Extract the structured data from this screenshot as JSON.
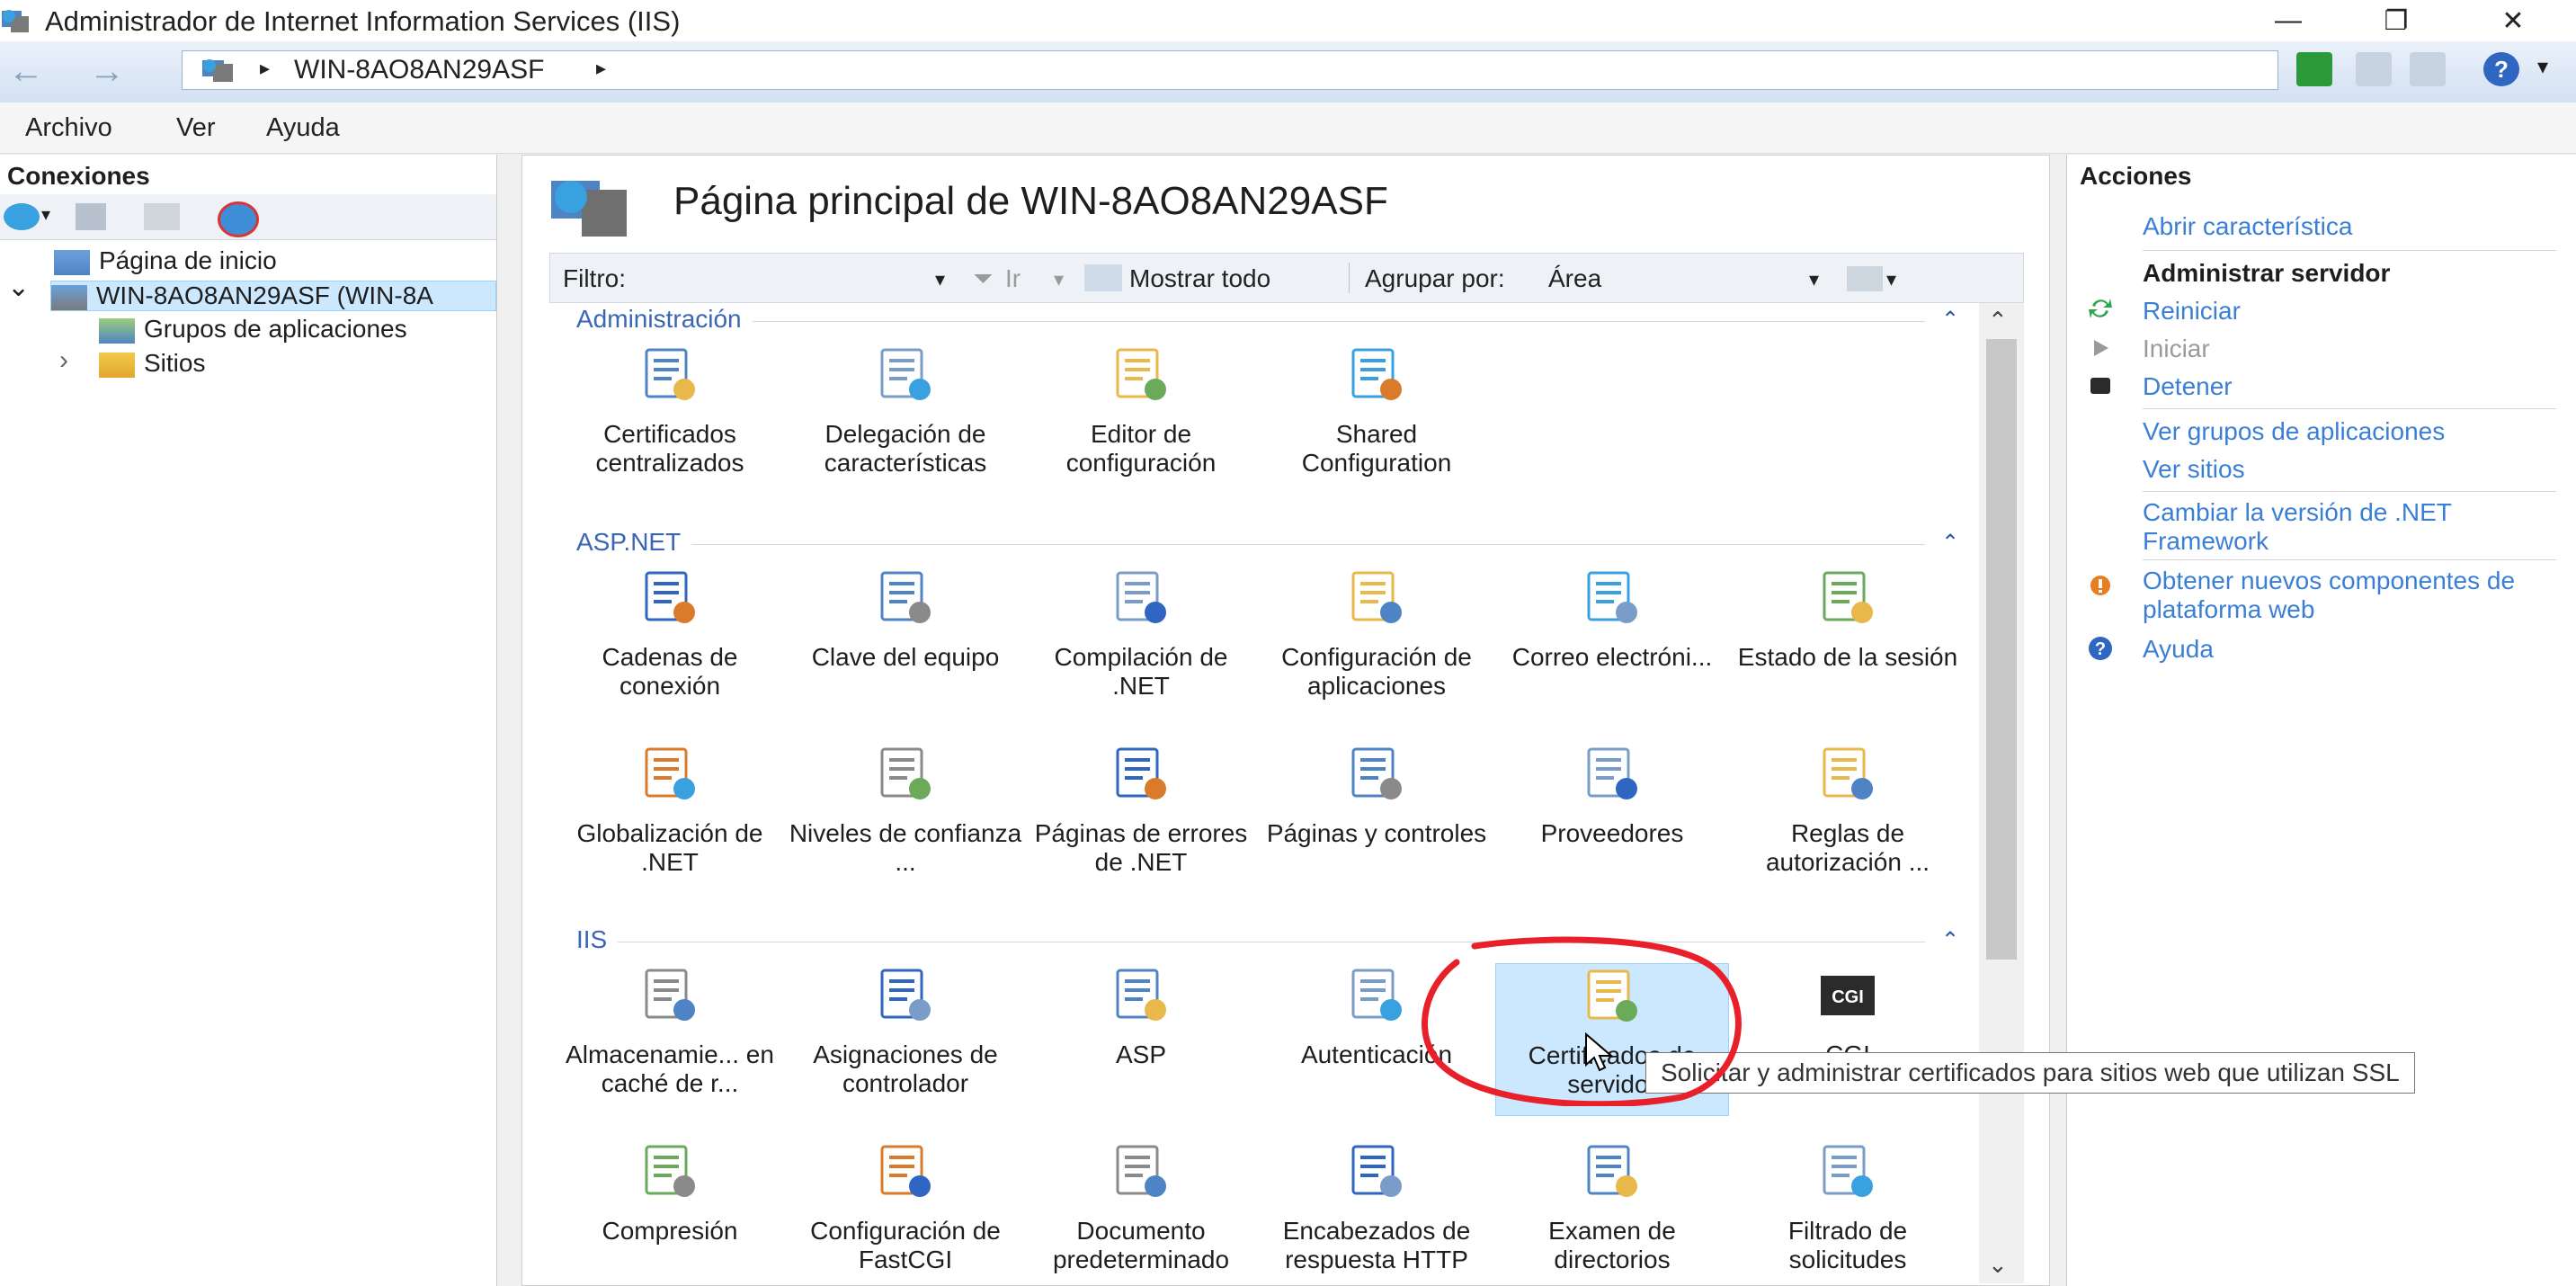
{
  "window": {
    "title": "Administrador de Internet Information Services (IIS)",
    "min_glyph": "—",
    "max_glyph": "❐",
    "close_glyph": "✕"
  },
  "address": {
    "back_glyph": "←",
    "forward_glyph": "→",
    "crumb": "WIN-8AO8AN29ASF",
    "sep_glyph": "▸"
  },
  "menu": {
    "file": "Archivo",
    "view": "Ver",
    "help": "Ayuda"
  },
  "connections": {
    "header": "Conexiones",
    "tree": [
      {
        "label": "Página de inicio"
      },
      {
        "label": "WIN-8AO8AN29ASF (WIN-8A"
      },
      {
        "label": "Grupos de aplicaciones"
      },
      {
        "label": "Sitios"
      }
    ],
    "expand_glyph": "›",
    "collapse_glyph": "⌄"
  },
  "main": {
    "title": "Página principal de WIN-8AO8AN29ASF",
    "filter_label": "Filtro:",
    "go_label": "Ir",
    "show_all_label": "Mostrar todo",
    "group_by_label": "Agrupar por:",
    "group_by_value": "Área",
    "sections": [
      {
        "name": "Administración",
        "features": [
          {
            "label": "Certificados centralizados",
            "icon": "cert-list-icon"
          },
          {
            "label": "Delegación de características",
            "icon": "delegation-icon"
          },
          {
            "label": "Editor de configuración",
            "icon": "config-editor-icon"
          },
          {
            "label": "Shared Configuration",
            "icon": "shared-config-icon"
          }
        ]
      },
      {
        "name": "ASP.NET",
        "features": [
          {
            "label": "Cadenas de conexión",
            "icon": "connection-strings-icon"
          },
          {
            "label": "Clave del equipo",
            "icon": "machine-key-icon"
          },
          {
            "label": "Compilación de .NET",
            "icon": "compilation-icon"
          },
          {
            "label": "Configuración de aplicaciones",
            "icon": "app-settings-icon"
          },
          {
            "label": "Correo electróni...",
            "icon": "smtp-email-icon"
          },
          {
            "label": "Estado de la sesión",
            "icon": "session-state-icon"
          },
          {
            "label": "Globalización de .NET",
            "icon": "globalization-icon"
          },
          {
            "label": "Niveles de confianza ...",
            "icon": "trust-levels-icon"
          },
          {
            "label": "Páginas de errores de .NET",
            "icon": "error-pages-icon"
          },
          {
            "label": "Páginas y controles",
            "icon": "pages-controls-icon"
          },
          {
            "label": "Proveedores",
            "icon": "providers-icon"
          },
          {
            "label": "Reglas de autorización ...",
            "icon": "authorization-rules-icon"
          }
        ]
      },
      {
        "name": "IIS",
        "features": [
          {
            "label": "Almacenamie... en caché de r...",
            "icon": "output-caching-icon"
          },
          {
            "label": "Asignaciones de controlador",
            "icon": "handler-mappings-icon"
          },
          {
            "label": "ASP",
            "icon": "asp-icon"
          },
          {
            "label": "Autenticación",
            "icon": "authentication-icon"
          },
          {
            "label": "Certificados de servidor",
            "icon": "server-certificates-icon"
          },
          {
            "label": "CGI",
            "icon": "cgi-icon"
          },
          {
            "label": "Compresión",
            "icon": "compression-icon"
          },
          {
            "label": "Configuración de FastCGI",
            "icon": "fastcgi-icon"
          },
          {
            "label": "Documento predeterminado",
            "icon": "default-document-icon"
          },
          {
            "label": "Encabezados de respuesta HTTP",
            "icon": "http-headers-icon"
          },
          {
            "label": "Examen de directorios",
            "icon": "directory-browsing-icon"
          },
          {
            "label": "Filtrado de solicitudes",
            "icon": "request-filtering-icon"
          }
        ]
      }
    ],
    "tooltip": "Solicitar y administrar certificados para sitios web que utilizan SSL"
  },
  "actions": {
    "header": "Acciones",
    "open_feature": "Abrir característica",
    "manage_server_header": "Administrar servidor",
    "restart": "Reiniciar",
    "start": "Iniciar",
    "stop": "Detener",
    "view_app_pools": "Ver grupos de aplicaciones",
    "view_sites": "Ver sitios",
    "change_net": "Cambiar la versión de .NET Framework",
    "get_components": "Obtener nuevos componentes de plataforma web",
    "help": "Ayuda"
  },
  "colors": {
    "accent_link": "#3a7fd5",
    "section_header": "#3b66b5",
    "selection": "#cce8ff",
    "annotation_red": "#e8202a"
  }
}
